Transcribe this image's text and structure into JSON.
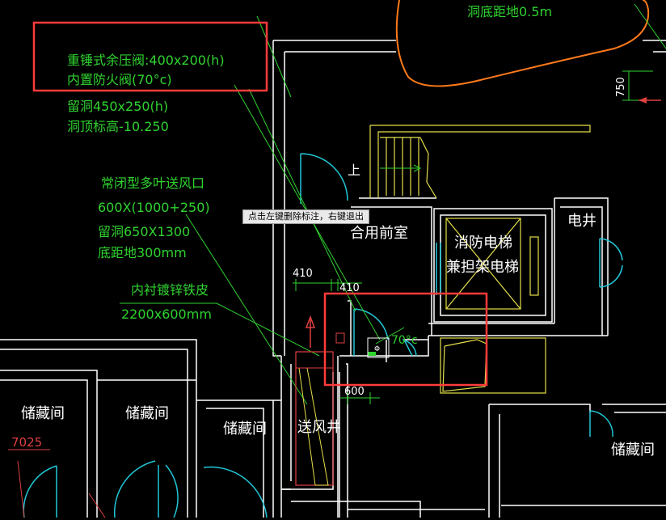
{
  "texts": {
    "top_note": "洞底距地0.5m",
    "dim_750": "750",
    "note_line1": "重锤式余压阀:400x200(h)",
    "note_line2": "内置防火阀(70°c)",
    "note_line3": "留洞450x250(h)",
    "note_line4": "洞顶标高-10.250",
    "vent_line1": "常闭型多叶送风口",
    "vent_line2": "600X(1000+250)",
    "vent_line3": "留洞650X1300",
    "vent_line4": "底距地300mm",
    "lining_line1": "内衬镀锌铁皮",
    "lining_line2": "2200x600mm",
    "up_label": "上",
    "anteroom": "合用前室",
    "elevator_line1": "消防电梯",
    "elevator_line2": "兼担架电梯",
    "electric_shaft": "电井",
    "dim_410_left": "410",
    "dim_410_right": "410",
    "label_70": "70°c",
    "dim_600": "600",
    "storage_1": "储藏间",
    "storage_2": "储藏间",
    "storage_3": "储藏间",
    "storage_4": "储藏间",
    "dim_7025": "7025",
    "air_shaft": "送风井",
    "phi_symbol": "Φ"
  },
  "tooltip": "点击左键删除标注，右键退出",
  "colors": {
    "background": "#000000",
    "wall": "#ffffff",
    "annotation_green": "#2fd32f",
    "door_cyan": "#22c8d8",
    "stair_yellow": "#e6e04a",
    "cloud_orange": "#ff7a1a",
    "highlight_red": "#ff3b3b",
    "dim_red": "#e04040"
  }
}
